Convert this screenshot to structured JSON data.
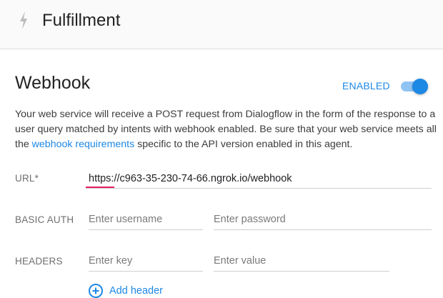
{
  "header": {
    "title": "Fulfillment",
    "icon": "bolt-icon"
  },
  "webhook": {
    "title": "Webhook",
    "status_label": "ENABLED",
    "enabled": true,
    "description_before_link": "Your web service will receive a POST request from Dialogflow in the form of the response to a user query matched by intents with webhook enabled. Be sure that your web service meets all the ",
    "description_link": "webhook requirements",
    "description_after_link": " specific to the API version enabled in this agent."
  },
  "form": {
    "url_label": "URL*",
    "url_value": "https://c963-35-230-74-66.ngrok.io/webhook",
    "basic_auth_label": "BASIC AUTH",
    "username_placeholder": "Enter username",
    "password_placeholder": "Enter password",
    "headers_label": "HEADERS",
    "key_placeholder": "Enter key",
    "value_placeholder": "Enter value",
    "add_header_label": "Add header"
  },
  "colors": {
    "accent": "#1e88e5",
    "error_underline": "#e91e63",
    "toggle_track": "#90c4f4"
  }
}
